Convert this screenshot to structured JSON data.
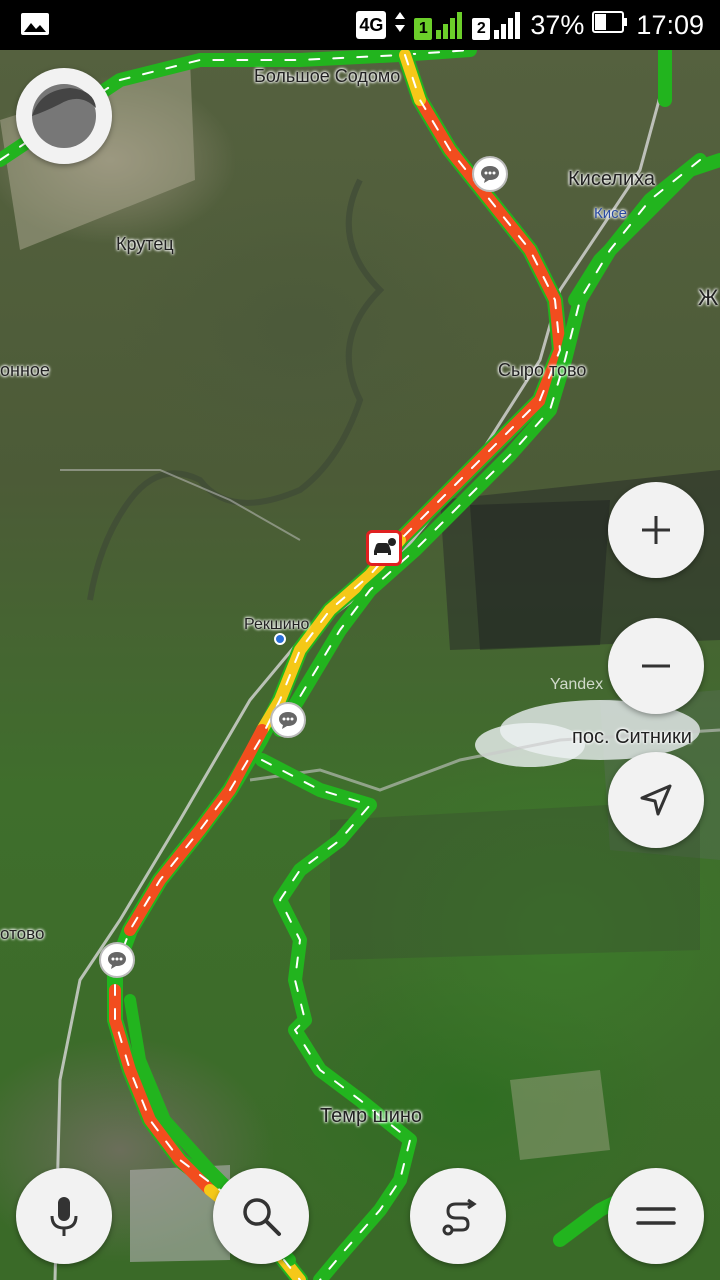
{
  "status_bar": {
    "network": "4G",
    "sim1": "1",
    "sim2": "2",
    "battery": "37%",
    "time": "17:09"
  },
  "map": {
    "places": {
      "bolshoe_sodomovo": "Большое Содомо",
      "kiselikha": "Киселиха",
      "kiselikha_small": "Кисе",
      "krutets": "Крутец",
      "syrovatovo": "Сыро тово",
      "onnoe": "онное",
      "reshkino": "Рекшино",
      "sitniki": "пос. Ситники",
      "otovo": "отово",
      "temrshino": "Темр шино",
      "zh": "Ж"
    },
    "watermark": "Yandex",
    "colors": {
      "free": "#22b41e",
      "medium": "#f5c818",
      "jam": "#f24d1e"
    }
  },
  "controls": {
    "zoom_in": "zoom-in",
    "zoom_out": "zoom-out",
    "locate": "navigation-arrow",
    "voice": "microphone",
    "search": "magnifier",
    "route": "route",
    "menu": "menu"
  }
}
